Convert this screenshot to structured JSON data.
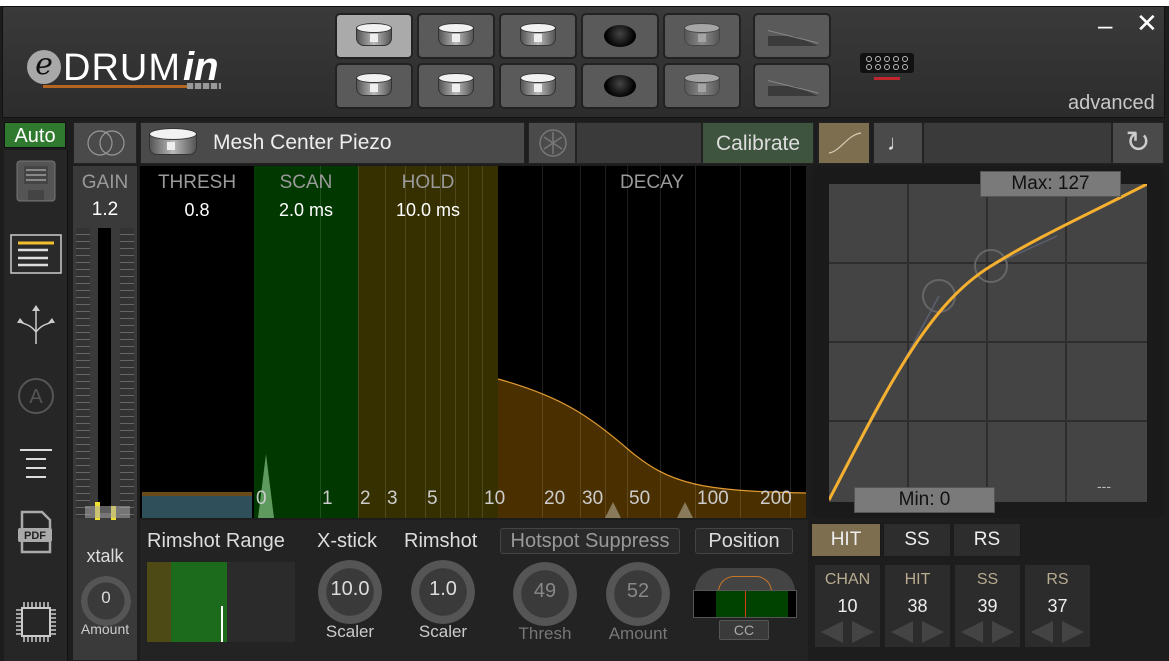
{
  "app": {
    "logo_prefix": "e",
    "logo_main": "DRUM",
    "logo_suffix": "in",
    "mode_label": "advanced"
  },
  "window": {
    "minimize": "–",
    "close": "✕"
  },
  "pads": {
    "row1": [
      {
        "type": "drum-icon",
        "active": true
      },
      {
        "type": "drum-icon",
        "active": false
      },
      {
        "type": "drum-icon",
        "active": false
      },
      {
        "type": "cymbal-icon",
        "active": false
      },
      {
        "type": "drum-icon-dim",
        "active": false
      },
      {
        "type": "pedal-icon",
        "active": false
      }
    ],
    "row2": [
      {
        "type": "drum-icon",
        "active": false
      },
      {
        "type": "drum-icon",
        "active": false
      },
      {
        "type": "drum-icon",
        "active": false
      },
      {
        "type": "cymbal-icon",
        "active": false
      },
      {
        "type": "drum-icon-dim",
        "active": false
      },
      {
        "type": "pedal-icon",
        "active": false
      }
    ]
  },
  "toolbar": {
    "auto_label": "Auto",
    "pad_name": "Mesh Center Piezo",
    "calibrate_label": "Calibrate",
    "note_symbol": "♩",
    "refresh_symbol": "↻"
  },
  "sidebar": {
    "items": [
      "save-icon",
      "list-icon",
      "split-arrows-icon",
      "auto-a-icon",
      "align-icon",
      "pdf-icon",
      "chip-icon"
    ],
    "pdf_label": "PDF",
    "auto_letter": "A"
  },
  "gain": {
    "label": "GAIN",
    "value": "1.2",
    "xtalk_label": "xtalk",
    "xtalk_value": "0",
    "xtalk_caption": "Amount"
  },
  "graph": {
    "thresh": {
      "label": "THRESH",
      "value": "0.8"
    },
    "scan": {
      "label": "SCAN",
      "value": "2.0 ms"
    },
    "hold": {
      "label": "HOLD",
      "value": "10.0 ms"
    },
    "decay": {
      "label": "DECAY"
    },
    "ticks": [
      "0",
      "1",
      "2",
      "3",
      "5",
      "10",
      "20",
      "30",
      "50",
      "100",
      "200"
    ],
    "colors": {
      "scan": "#003a00",
      "hold": "#363000",
      "decay": "#4a3000",
      "curve": "#f0a030"
    }
  },
  "velocity_curve": {
    "max_label": "Max: 127",
    "min_label": "Min: 0",
    "status": "---",
    "curve_color": "#f5b030"
  },
  "bottom": {
    "rimshot_range_label": "Rimshot Range",
    "xstick": {
      "label": "X-stick",
      "value": "10.0",
      "caption": "Scaler"
    },
    "rimshot": {
      "label": "Rimshot",
      "value": "1.0",
      "caption": "Scaler"
    },
    "hotspot": {
      "label": "Hotspot Suppress",
      "thresh_value": "49",
      "thresh_caption": "Thresh",
      "amount_value": "52",
      "amount_caption": "Amount"
    },
    "position": {
      "label": "Position",
      "cc_label": "CC"
    }
  },
  "midi": {
    "tabs": [
      {
        "label": "HIT",
        "active": true
      },
      {
        "label": "SS",
        "active": false
      },
      {
        "label": "RS",
        "active": false
      }
    ],
    "fields": [
      {
        "label": "CHAN",
        "value": "10"
      },
      {
        "label": "HIT",
        "value": "38"
      },
      {
        "label": "SS",
        "value": "39"
      },
      {
        "label": "RS",
        "value": "37"
      }
    ]
  }
}
